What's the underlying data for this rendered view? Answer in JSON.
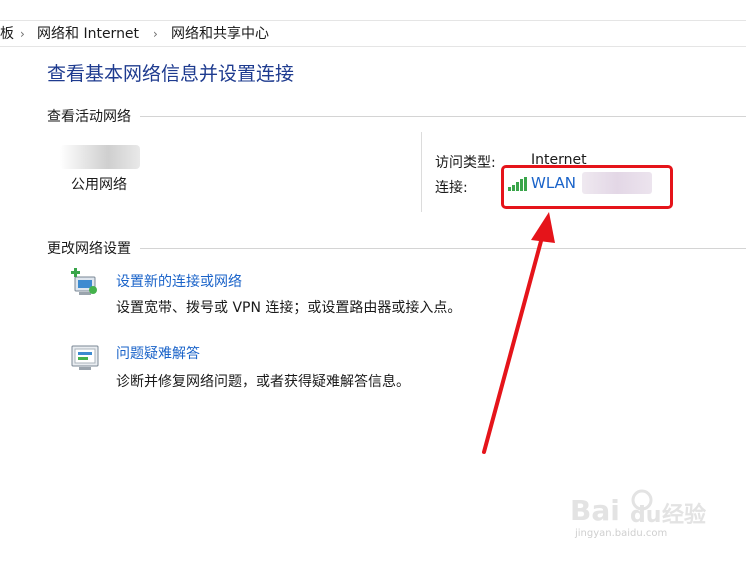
{
  "breadcrumb": {
    "item_0": "板",
    "item_1": "网络和 Internet",
    "item_2": "网络和共享中心"
  },
  "page_title": "查看基本网络信息并设置连接",
  "active_network": {
    "section_title": "查看活动网络",
    "network_type": "公用网络",
    "access_type_label": "访问类型:",
    "access_type_value": "Internet",
    "connection_label": "连接:",
    "connection_value": "WLAN"
  },
  "change_settings": {
    "section_title": "更改网络设置",
    "tasks": [
      {
        "link": "设置新的连接或网络",
        "description": "设置宽带、拨号或 VPN 连接；或设置路由器或接入点。"
      },
      {
        "link": "问题疑难解答",
        "description": "诊断并修复网络问题，或者获得疑难解答信息。"
      }
    ]
  },
  "watermark": {
    "brand": "Bai du 经验",
    "url": "jingyan.baidu.com"
  },
  "colors": {
    "title_blue": "#1e3b8f",
    "link_blue": "#1a63c9",
    "annotation_red": "#e5141a",
    "signal_green": "#3aa54a"
  },
  "icons": [
    "signal-bars-icon",
    "new-connection-icon",
    "troubleshoot-icon",
    "chevron-right-icon"
  ]
}
